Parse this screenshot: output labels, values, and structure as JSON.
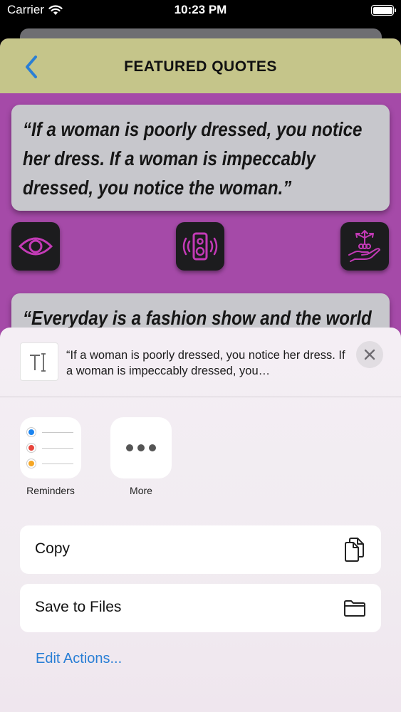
{
  "status_bar": {
    "carrier": "Carrier",
    "time": "10:23 PM"
  },
  "nav": {
    "title": "FEATURED QUOTES"
  },
  "quotes": [
    "“If a woman is poorly dressed, you notice her dress. If a woman is impeccably dressed, you notice the woman.”",
    "“Everyday is a fashion show and the world"
  ],
  "share_sheet": {
    "preview_text": "“If a woman is poorly dressed, you notice her dress. If a woman is impeccably dressed, you…",
    "apps": [
      {
        "label": "Reminders",
        "icon": "reminders-icon"
      },
      {
        "label": "More",
        "icon": "more-icon"
      }
    ],
    "actions": [
      {
        "label": "Copy",
        "icon": "copy-icon"
      },
      {
        "label": "Save to Files",
        "icon": "folder-icon"
      }
    ],
    "edit_actions": "Edit Actions..."
  },
  "colors": {
    "app_background": "#a54aa8",
    "nav_background": "#c5c58a",
    "accent_blue": "#2a7fd5",
    "icon_magenta": "#c33ab6"
  }
}
